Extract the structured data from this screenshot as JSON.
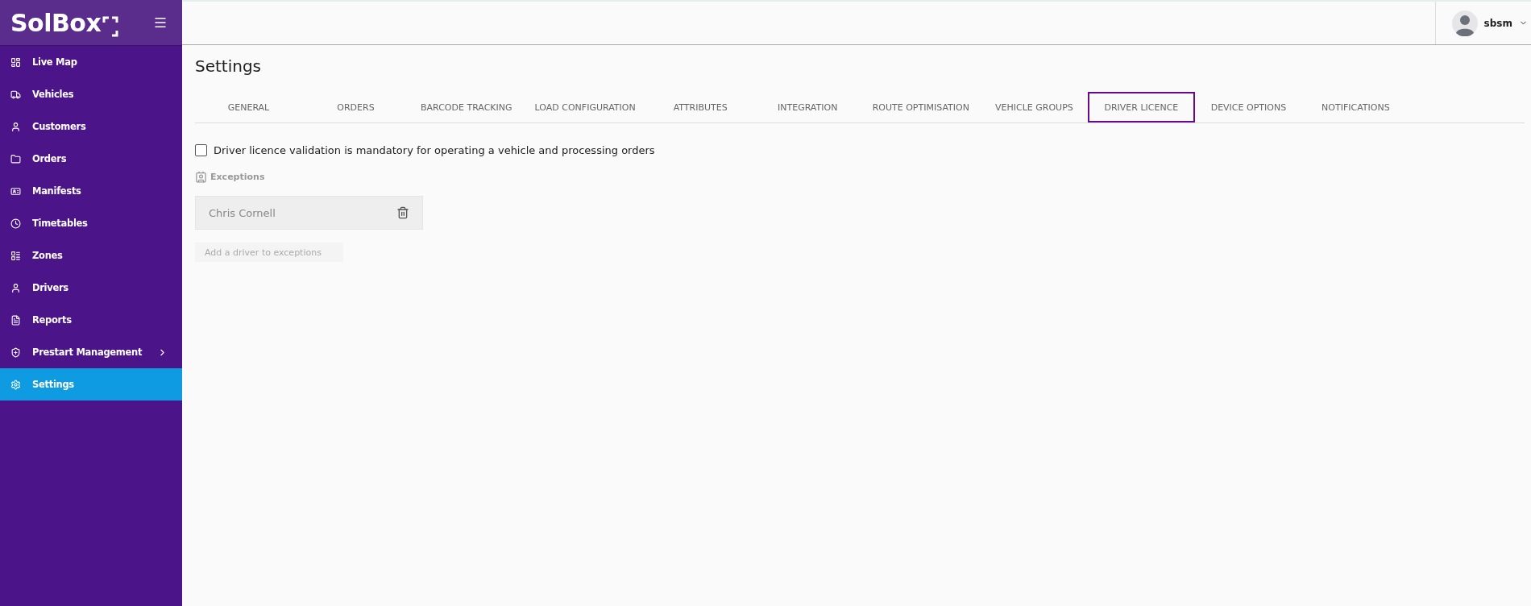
{
  "sidebar": {
    "logo": "SolBox",
    "items": [
      {
        "label": "Live Map",
        "selected": false,
        "expandable": false
      },
      {
        "label": "Vehicles",
        "selected": false,
        "expandable": false
      },
      {
        "label": "Customers",
        "selected": false,
        "expandable": false
      },
      {
        "label": "Orders",
        "selected": false,
        "expandable": false
      },
      {
        "label": "Manifests",
        "selected": false,
        "expandable": false
      },
      {
        "label": "Timetables",
        "selected": false,
        "expandable": false
      },
      {
        "label": "Zones",
        "selected": false,
        "expandable": false
      },
      {
        "label": "Drivers",
        "selected": false,
        "expandable": false
      },
      {
        "label": "Reports",
        "selected": false,
        "expandable": false
      },
      {
        "label": "Prestart Management",
        "selected": false,
        "expandable": true
      },
      {
        "label": "Settings",
        "selected": true,
        "expandable": false
      }
    ]
  },
  "header": {
    "user": "sbsm"
  },
  "page": {
    "title": "Settings"
  },
  "tabs": [
    {
      "label": "GENERAL",
      "selected": false
    },
    {
      "label": "ORDERS",
      "selected": false
    },
    {
      "label": "BARCODE TRACKING",
      "selected": false
    },
    {
      "label": "LOAD CONFIGURATION",
      "selected": false
    },
    {
      "label": "ATTRIBUTES",
      "selected": false
    },
    {
      "label": "INTEGRATION",
      "selected": false
    },
    {
      "label": "ROUTE OPTIMISATION",
      "selected": false
    },
    {
      "label": "VEHICLE GROUPS",
      "selected": false
    },
    {
      "label": "DRIVER LICENCE",
      "selected": true
    },
    {
      "label": "DEVICE OPTIONS",
      "selected": false
    },
    {
      "label": "NOTIFICATIONS",
      "selected": false
    }
  ],
  "mandatory": {
    "label": "Driver licence validation is mandatory for operating a vehicle and processing orders",
    "checked": false
  },
  "exceptions": {
    "heading": "Exceptions",
    "drivers": [
      "Chris Cornell"
    ],
    "add_placeholder": "Add a driver to exceptions"
  }
}
